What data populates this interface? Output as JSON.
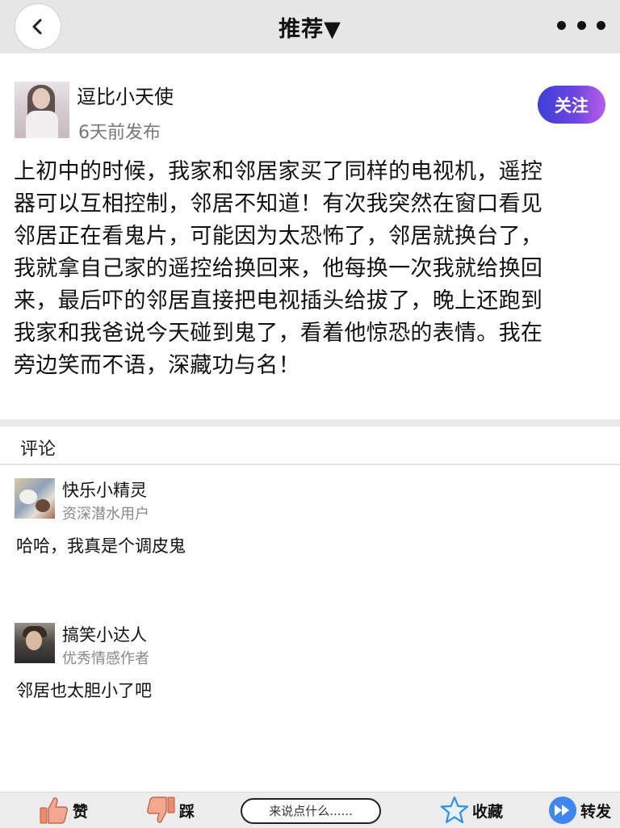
{
  "header": {
    "title": "推荐▼"
  },
  "post": {
    "author_name": "逗比小天使",
    "time": "6天前发布",
    "follow_label": "关注",
    "lines": [
      "上初中的时候，我家和邻居家买了同样的电视机，遥控",
      "器可以互相控制，邻居不知道！有次我突然在窗口看见",
      "邻居正在看鬼片，可能因为太恐怖了，邻居就换台了，",
      "我就拿自己家的遥控给换回来，他每换一次我就给换回",
      "来，最后吓的邻居直接把电视插头给拔了，晚上还跑到",
      "我家和我爸说今天碰到鬼了，看着他惊恐的表情。我在",
      "旁边笑而不语，深藏功与名！"
    ]
  },
  "comments": {
    "heading": "评论",
    "items": [
      {
        "name": "快乐小精灵",
        "role": "资深潜水用户",
        "text": "哈哈，我真是个调皮鬼"
      },
      {
        "name": "搞笑小达人",
        "role": "优秀情感作者",
        "text": "邻居也太胆小了吧"
      }
    ]
  },
  "bottom_bar": {
    "like_label": "赞",
    "dislike_label": "踩",
    "comment_placeholder": "来说点什么......",
    "favorite_label": "收藏",
    "share_label": "转发"
  },
  "colors": {
    "topbar_bg": "#e6e6e6",
    "follow_gradient": [
      "#3b3fd8",
      "#b85ee8"
    ],
    "thumb_icon": "#f08a6c",
    "star_icon": "#2f8ff0",
    "share_icon": "#3f86f0"
  },
  "icons": [
    "back-chevron-icon",
    "more-dots-icon",
    "thumbs-up-icon",
    "thumbs-down-icon",
    "star-icon",
    "fast-forward-icon"
  ]
}
